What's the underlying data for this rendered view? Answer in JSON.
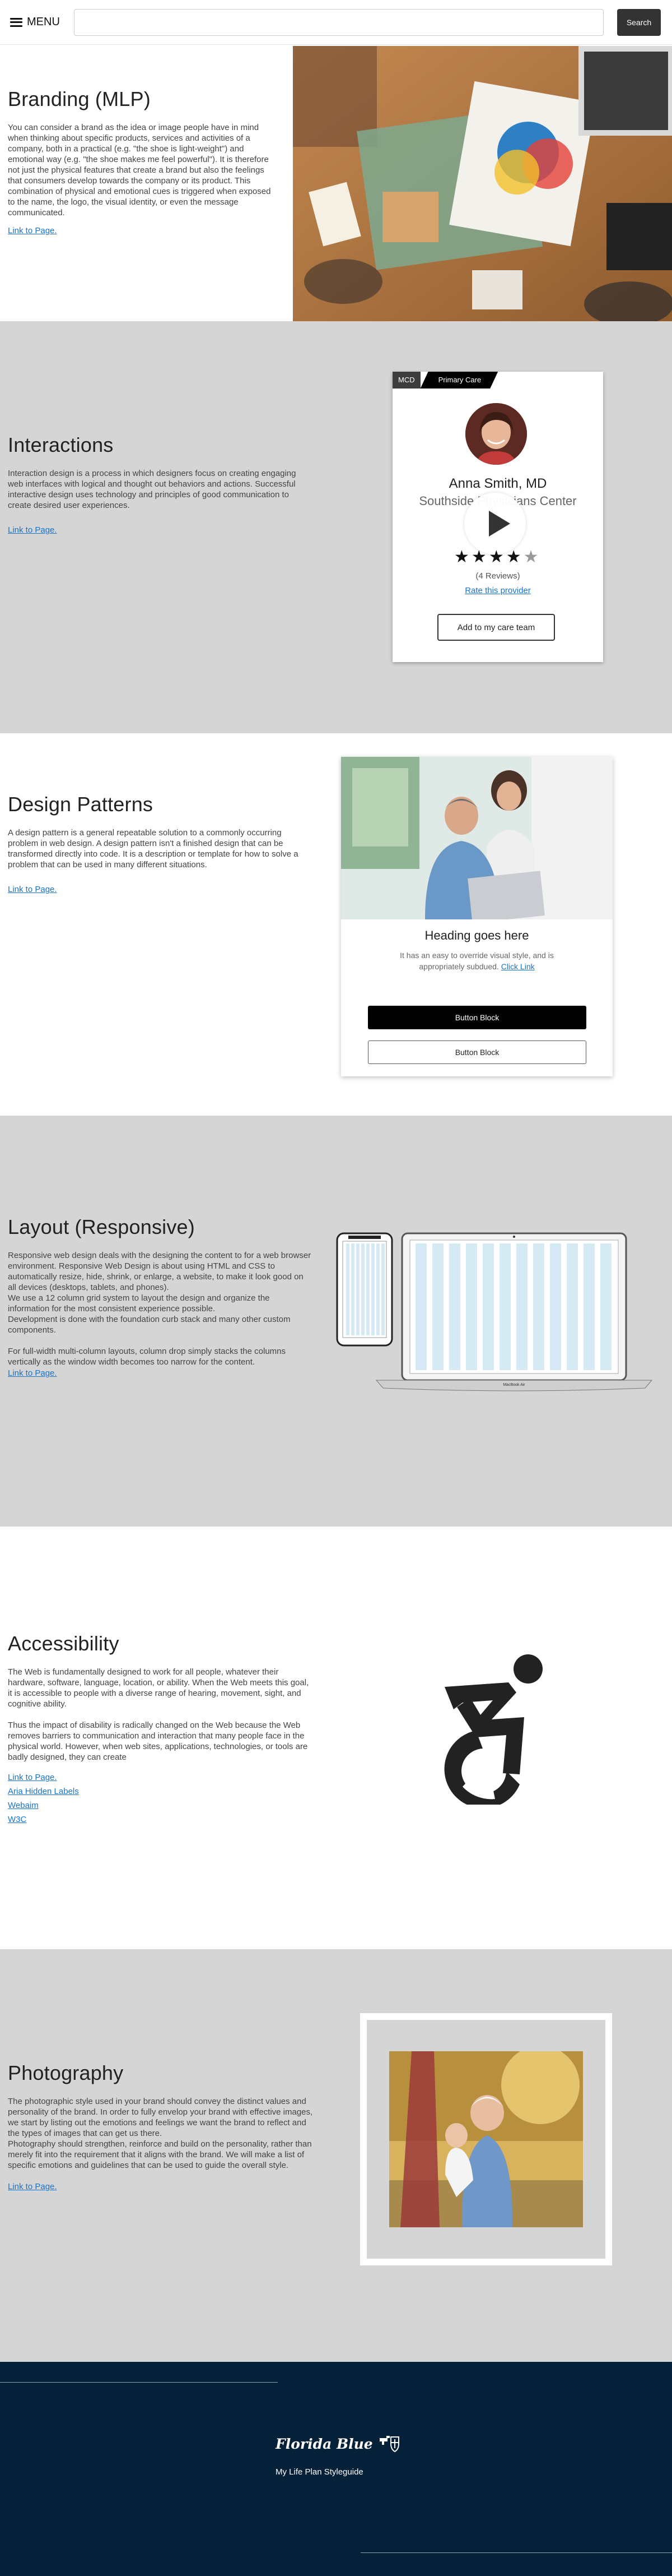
{
  "header": {
    "menu_label": "MENU",
    "search_placeholder": "",
    "search_button": "Search"
  },
  "branding": {
    "title": "Branding (MLP)",
    "body": "You can consider a brand as the idea or image people have in mind when thinking about specific products, services and activities of a company, both in a practical (e.g. \"the shoe is light-weight\") and emotional way (e.g. \"the shoe makes me feel powerful\"). It is therefore not just the physical features that create a brand but also the feelings that consumers develop towards the company or its product. This combination of physical and emotional cues is triggered when exposed to the name, the logo, the visual identity, or even the message communicated.",
    "link": "Link to Page."
  },
  "interactions": {
    "title": "Interactions",
    "body": "Interaction design is a process in which designers focus on creating engaging web interfaces with logical and thought out behaviors and actions. Successful interactive design uses technology and principles of good communication to create desired user experiences.",
    "link": "Link to Page.",
    "card": {
      "tag_mcd": "MCD",
      "tag_primary": "Primary Care",
      "name": "Anna Smith, MD",
      "org": "Southside Physicians Center",
      "rating": 4,
      "rating_max": 5,
      "reviews": "(4 Reviews)",
      "rate_link": "Rate this provider",
      "button": "Add to my care team"
    }
  },
  "patterns": {
    "title": "Design Patterns",
    "body": "A design pattern is a general repeatable solution to a commonly occurring problem in web design. A design pattern isn't a finished design that can be transformed directly into code. It is a description or template for how to solve a problem that can be used in many different situations.",
    "link": "Link to Page.",
    "card": {
      "heading": "Heading goes here",
      "text": "It has an easy to override visual style, and is appropriately subdued.",
      "click_link": "Click Link",
      "button_dark": "Button Block",
      "button_light": "Button Block"
    }
  },
  "layout": {
    "title": "Layout (Responsive)",
    "p1": "Responsive web design deals with the designing the content to for a web browser environment. Responsive Web Design is about using HTML and CSS to automatically resize, hide, shrink, or enlarge, a website, to make it look good on all devices (desktops, tablets, and phones).",
    "p2": "We use a 12 column grid system to layout the design and organize the information for the most consistent experience possible.",
    "p3": "Development is done with the foundation curb stack and many other custom components.",
    "p4": "For full-width multi-column layouts, column drop simply stacks the columns vertically as the window width becomes too narrow for the content.",
    "link": "Link to Page.",
    "laptop_label": "MacBook Air"
  },
  "accessibility": {
    "title": "Accessibility",
    "p1": "The Web is fundamentally designed to work for all people, whatever their hardware, software, language, location, or ability. When the Web meets this goal, it is accessible to people with a diverse range of hearing, movement, sight, and cognitive ability.",
    "p2": "Thus the impact of disability is radically changed on the Web because the Web removes barriers to communication and interaction that many people face in the physical world. However, when web sites, applications, technologies, or tools are badly designed, they can create",
    "links": [
      "Link to Page.",
      "Aria Hidden Labels",
      "Webaim",
      "W3C"
    ]
  },
  "photography": {
    "title": "Photography",
    "p1": "The photographic style used in your brand should convey the distinct values and personality of the brand. In order to fully envelop your brand with effective images, we start by listing out the emotions and feelings we want the brand to reflect and the types of images that can get us there.",
    "p2": "Photography should strengthen, reinforce and build on the personality, rather than merely fit into the requirement that it aligns with the brand. We will make a list of specific emotions and guidelines that can be used to guide the overall style.",
    "link": "Link to Page."
  },
  "footer": {
    "brand": "Florida Blue",
    "subtitle": "My Life Plan Styleguide"
  },
  "colors": {
    "footer_bg": "#05213a",
    "section_gray": "#d5d5d5",
    "link": "#1a73c9",
    "button_dark": "#000000"
  }
}
